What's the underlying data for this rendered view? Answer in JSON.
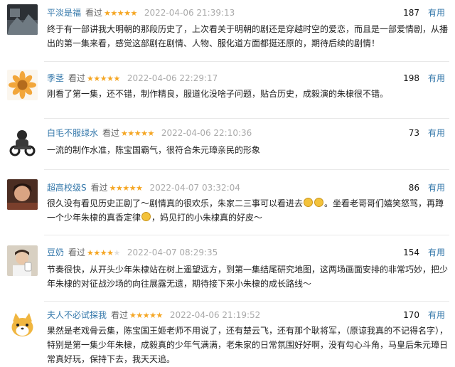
{
  "reviews": [
    {
      "name": "平淡是福",
      "watched": "看过",
      "rating": 5,
      "time": "2022-04-06 21:39:13",
      "votes": "187",
      "useful_label": "有用",
      "text": "终于有一部讲我大明朝的那段历史了，上次看关于明朝的剧还是穿越时空的爱恋，而且是一部爱情剧，从播出的第一集来看，感觉这部剧在剧情、人物、服化道方面都挺还原的，期待后续的剧情！"
    },
    {
      "name": "季茎",
      "watched": "看过",
      "rating": 5,
      "time": "2022-04-06 22:29:17",
      "votes": "198",
      "useful_label": "有用",
      "text": "刚看了第一集，还不错，制作精良，服道化没啥子问题，贴合历史，成毅演的朱棣很不错。"
    },
    {
      "name": "白毛不服绿水",
      "watched": "看过",
      "rating": 5,
      "time": "2022-04-06 22:10:36",
      "votes": "73",
      "useful_label": "有用",
      "text": "一流的制作水准，陈宝国霸气，很符合朱元璋亲民的形象"
    },
    {
      "name": "超高校级S",
      "watched": "看过",
      "rating": 5,
      "time": "2022-04-07 03:32:04",
      "votes": "86",
      "useful_label": "有用",
      "text_a": "很久没有看见历史正剧了～剧情真的很欢乐，朱家二三事可以看进去",
      "text_b": "。坐看老哥哥们嬉笑怒骂，再蹲一个少年朱棣的真香定律",
      "text_c": "，妈见打的小朱棣真的好皮～"
    },
    {
      "name": "豆奶",
      "watched": "看过",
      "rating": 4,
      "time": "2022-04-07 08:29:35",
      "votes": "154",
      "useful_label": "有用",
      "text": "节奏很快，从开头少年朱棣站在树上遥望远方，到第一集结尾研究地图，这两场画面安排的非常巧妙，把少年朱棣的对征战沙场的向往展露无遗，期待接下来小朱棣的成长路线～"
    },
    {
      "name": "夫人不必试探我",
      "watched": "看过",
      "rating": 5,
      "time": "2022-04-06 21:19:52",
      "votes": "170",
      "useful_label": "有用",
      "text": "果然是老戏骨云集，陈宝国王姬老师不用说了，还有楚云飞，还有那个耿将军，（原谅我真的不记得名字），特别是第一集少年朱棣，成毅真的少年气满满，老朱家的日常氛围好好啊，没有勾心斗角，马皇后朱元璋日常真好玩，保持下去，我天天追。"
    }
  ],
  "colors": {
    "link": "#3377aa",
    "star": "#f5a623",
    "time": "#aaaaaa"
  }
}
